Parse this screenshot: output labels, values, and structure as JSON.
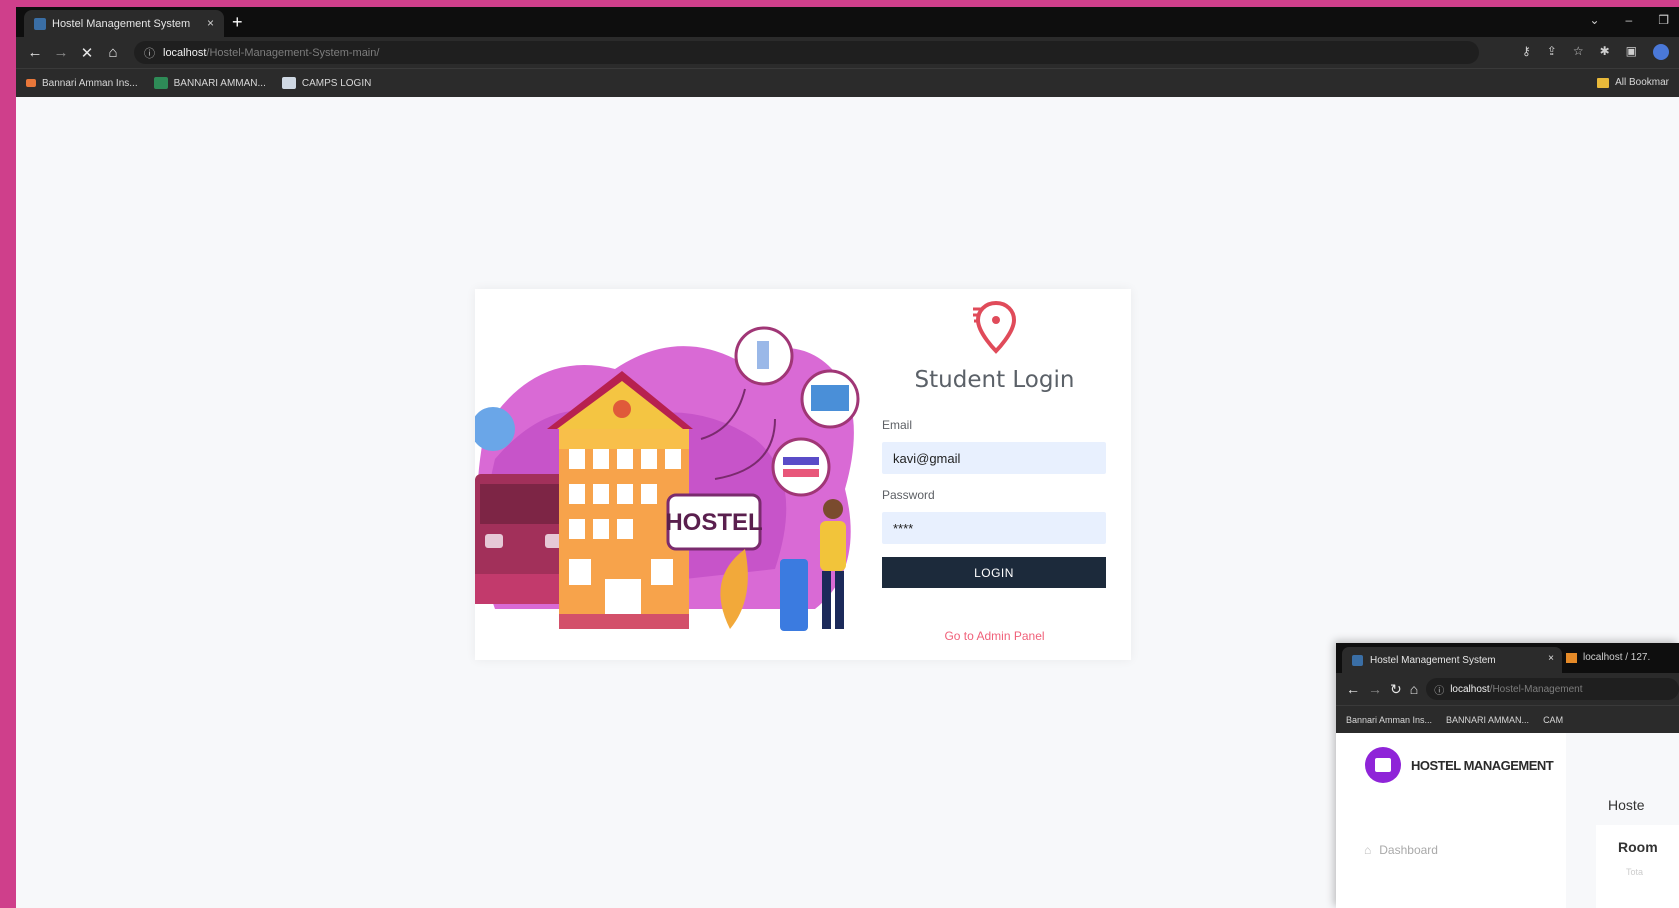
{
  "main_browser": {
    "tab_title": "Hostel Management System",
    "tab_close": "×",
    "new_tab": "+",
    "url_host": "localhost",
    "url_path": "/Hostel-Management-System-main/",
    "bookmarks": [
      {
        "label": "Bannari Amman Ins...",
        "color": "#e8773a"
      },
      {
        "label": "BANNARI AMMAN...",
        "color": "#2e8b57"
      },
      {
        "label": "CAMPS LOGIN",
        "color": "#cfd8e3"
      }
    ],
    "all_bookmarks": "All Bookmar"
  },
  "login": {
    "illustration_text": "HOSTEL",
    "title": "Student Login",
    "email_label": "Email",
    "email_value": "kavi@gmail",
    "password_label": "Password",
    "password_value": "****",
    "login_button": "LOGIN",
    "admin_link": "Go to Admin Panel"
  },
  "secondary_browser": {
    "tab1_title": "Hostel Management System",
    "tab1_close": "×",
    "tab2_title": "localhost / 127.",
    "url_host": "localhost",
    "url_path": "/Hostel-Management",
    "bookmarks": [
      "Bannari Amman Ins...",
      "BANNARI AMMAN...",
      "CAM"
    ],
    "brand": "HOSTEL MANAGEMENT",
    "sidebar_item": "Dashboard",
    "main_heading": "Hoste",
    "panel_title": "Room",
    "panel_sub": "Tota"
  },
  "colors": {
    "accent_pink": "#f0617a",
    "dark_button": "#1c2a3b",
    "frame": "#cf3f8b",
    "brand_purple": "#8f24d8"
  }
}
